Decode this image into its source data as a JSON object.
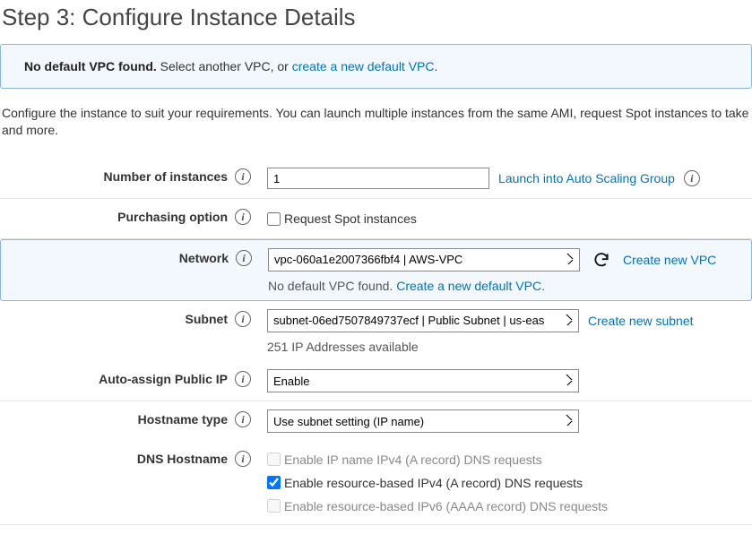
{
  "page_title": "Step 3: Configure Instance Details",
  "notice": {
    "bold": "No default VPC found.",
    "text": " Select another VPC, or ",
    "link": "create a new default VPC",
    "after": "."
  },
  "intro": "Configure the instance to suit your requirements. You can launch multiple instances from the same AMI, request Spot instances to take and more.",
  "fields": {
    "num_instances": {
      "label": "Number of instances",
      "value": "1",
      "side_link": "Launch into Auto Scaling Group"
    },
    "purchasing": {
      "label": "Purchasing option",
      "checkbox_label": "Request Spot instances"
    },
    "network": {
      "label": "Network",
      "value": "vpc-060a1e2007366fbf4 | AWS-VPC",
      "side_link": "Create new VPC",
      "sub_prefix": "No default VPC found. ",
      "sub_link": "Create a new default VPC",
      "sub_after": "."
    },
    "subnet": {
      "label": "Subnet",
      "value": "subnet-06ed7507849737ecf | Public Subnet | us-eas",
      "side_link": "Create new subnet",
      "subtext": "251 IP Addresses available"
    },
    "public_ip": {
      "label": "Auto-assign Public IP",
      "value": "Enable"
    },
    "hostname": {
      "label": "Hostname type",
      "value": "Use subnet setting (IP name)"
    },
    "dns": {
      "label": "DNS Hostname",
      "cb1": "Enable IP name IPv4 (A record) DNS requests",
      "cb2": "Enable resource-based IPv4 (A record) DNS requests",
      "cb3": "Enable resource-based IPv6 (AAAA record) DNS requests"
    }
  }
}
